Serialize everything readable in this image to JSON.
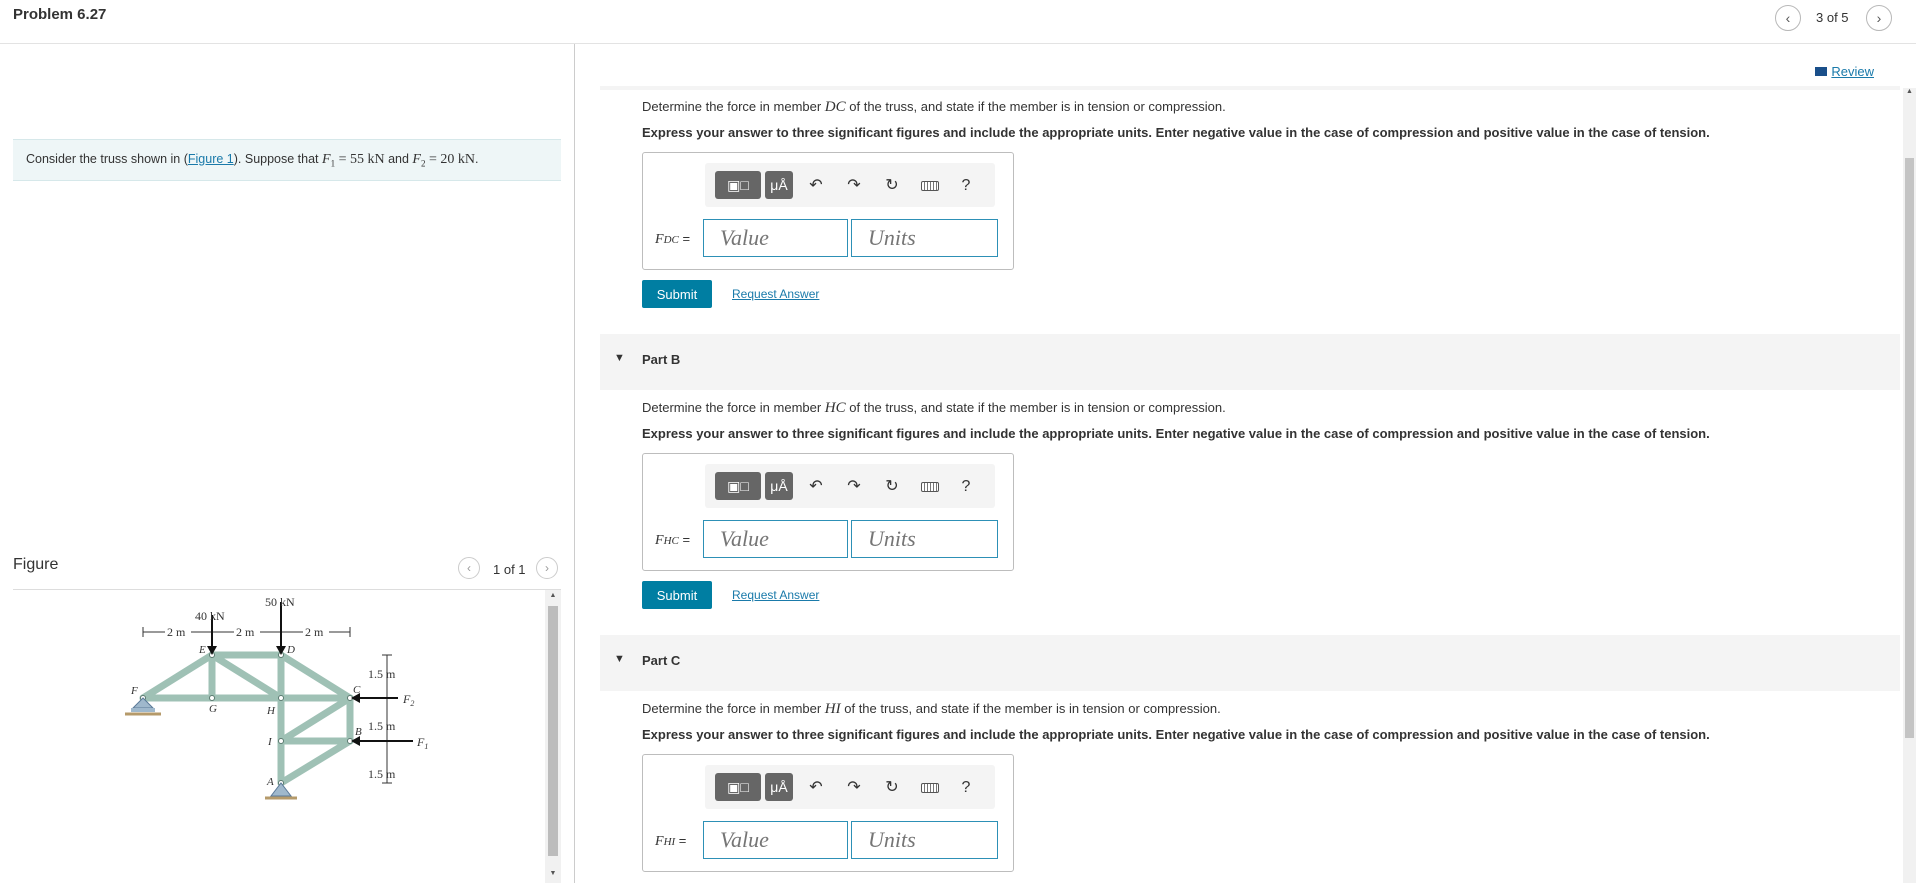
{
  "header": {
    "problem_title": "Problem 6.27",
    "page_count": "3 of 5",
    "prev_icon": "chevron-left-icon",
    "next_icon": "chevron-right-icon"
  },
  "intro": {
    "text_before": "Consider the truss shown in (",
    "figure_link": "Figure 1",
    "text_mid": "). Suppose that ",
    "f1_symbol": "F",
    "f1_sub": "1",
    "f1_value": " = 55 kN",
    "and": " and ",
    "f2_symbol": "F",
    "f2_sub": "2",
    "f2_value": " = 20 kN",
    "end": "."
  },
  "figure": {
    "label": "Figure",
    "count": "1 of 1",
    "labels": {
      "load_e": "40 kN",
      "load_d": "50 kN",
      "dim1": "2 m",
      "dim2": "2 m",
      "dim3": "2 m",
      "h1": "1.5 m",
      "h2": "1.5 m",
      "h3": "1.5 m",
      "f2": "F",
      "f2_sub": "2",
      "f1": "F",
      "f1_sub": "1",
      "node_e": "E",
      "node_d": "D",
      "node_c": "C",
      "node_f": "F",
      "node_g": "G",
      "node_h": "H",
      "node_b": "B",
      "node_i": "I",
      "node_a": "A"
    }
  },
  "review": {
    "label": "Review"
  },
  "toolbar": {
    "template_icon": "template-icon",
    "units_btn": "μÅ",
    "undo_icon": "↶",
    "redo_icon": "↷",
    "reset_icon": "↻",
    "keyboard_icon": "keyboard-icon",
    "help_label": "?"
  },
  "partA": {
    "question_pre": "Determine the force in member ",
    "member": "DC",
    "question_post": " of the truss, and state if the member is in tension or compression.",
    "instruction": "Express your answer to three significant figures and include the appropriate units. Enter negative value in the case of compression and positive value in the case of tension.",
    "var_symbol": "F",
    "var_sub": "DC",
    "eq": " =",
    "value_placeholder": "Value",
    "units_placeholder": "Units",
    "submit": "Submit",
    "request": "Request Answer"
  },
  "partB": {
    "title": "Part B",
    "question_pre": "Determine the force in member ",
    "member": "HC",
    "question_post": " of the truss, and state if the member is in tension or compression.",
    "instruction": "Express your answer to three significant figures and include the appropriate units. Enter negative value in the case of compression and positive value in the case of tension.",
    "var_symbol": "F",
    "var_sub": "HC",
    "eq": " =",
    "value_placeholder": "Value",
    "units_placeholder": "Units",
    "submit": "Submit",
    "request": "Request Answer"
  },
  "partC": {
    "title": "Part C",
    "question_pre": "Determine the force in member ",
    "member": "HI",
    "question_post": " of the truss, and state if the member is in tension or compression.",
    "instruction": "Express your answer to three significant figures and include the appropriate units. Enter negative value in the case of compression and positive value in the case of tension.",
    "var_symbol": "F",
    "var_sub": "HI",
    "eq": " =",
    "value_placeholder": "Value",
    "units_placeholder": "Units"
  },
  "colors": {
    "accent": "#007ea2",
    "link": "#1a7aaa",
    "truss": "#9fc1b5",
    "support": "#9fb8cc"
  }
}
